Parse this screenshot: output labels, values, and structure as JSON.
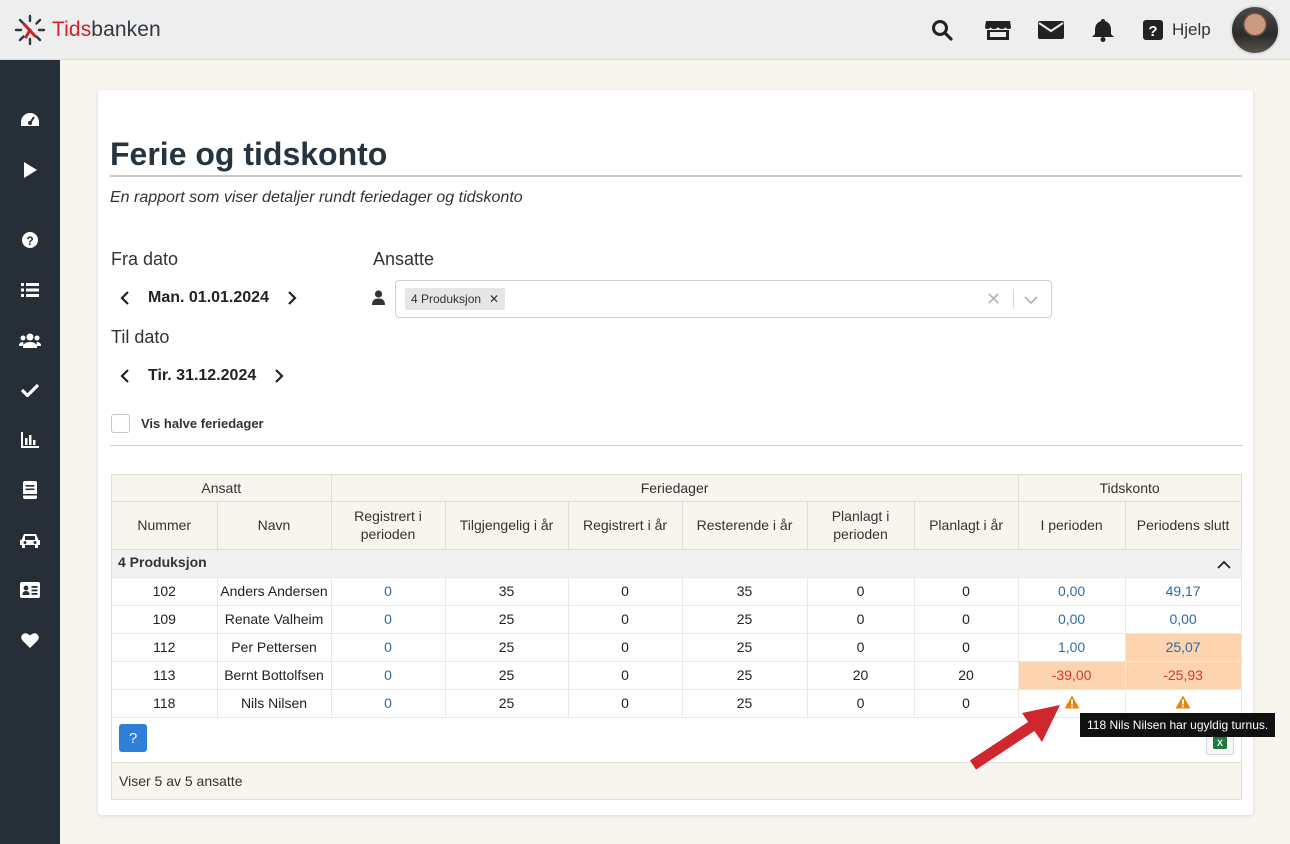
{
  "app": {
    "logo_prefix": "Tids",
    "logo_suffix": "banken"
  },
  "topbar": {
    "icons": [
      "search-icon",
      "store-icon",
      "mail-icon",
      "bell-icon",
      "help-icon"
    ],
    "help_label": "Hjelp"
  },
  "sidebar": {
    "items": [
      "dashboard-icon",
      "play-icon",
      "question-icon",
      "list-icon",
      "users-icon",
      "check-icon",
      "chart-icon",
      "book-icon",
      "car-icon",
      "id-card-icon",
      "heart-icon"
    ]
  },
  "page": {
    "title": "Ferie og tidskonto",
    "subtitle": "En rapport som viser detaljer rundt feriedager og tidskonto"
  },
  "filters": {
    "from_label": "Fra dato",
    "from_value": "Man. 01.01.2024",
    "to_label": "Til dato",
    "to_value": "Tir. 31.12.2024",
    "employees_label": "Ansatte",
    "employees_chip": "4 Produksjon",
    "half_days_label": "Vis halve feriedager"
  },
  "table": {
    "groups": [
      "Ansatt",
      "Feriedager",
      "Tidskonto"
    ],
    "columns": [
      "Nummer",
      "Navn",
      "Registrert i perioden",
      "Tilgjengelig i år",
      "Registrert i år",
      "Resterende i år",
      "Planlagt i perioden",
      "Planlagt i år",
      "I perioden",
      "Periodens slutt"
    ],
    "group_row": "4 Produksjon",
    "rows": [
      {
        "nummer": "102",
        "navn": "Anders Andersen",
        "reg_periode": "0",
        "tilgj": "35",
        "reg_aar": "0",
        "rest": "35",
        "plan_periode": "0",
        "plan_aar": "0",
        "i_perioden": "0,00",
        "slutt": "49,17"
      },
      {
        "nummer": "109",
        "navn": "Renate Valheim",
        "reg_periode": "0",
        "tilgj": "25",
        "reg_aar": "0",
        "rest": "25",
        "plan_periode": "0",
        "plan_aar": "0",
        "i_perioden": "0,00",
        "slutt": "0,00"
      },
      {
        "nummer": "112",
        "navn": "Per Pettersen",
        "reg_periode": "0",
        "tilgj": "25",
        "reg_aar": "0",
        "rest": "25",
        "plan_periode": "0",
        "plan_aar": "0",
        "i_perioden": "1,00",
        "slutt": "25,07"
      },
      {
        "nummer": "113",
        "navn": "Bernt Bottolfsen",
        "reg_periode": "0",
        "tilgj": "25",
        "reg_aar": "0",
        "rest": "25",
        "plan_periode": "20",
        "plan_aar": "20",
        "i_perioden": "-39,00",
        "slutt": "-25,93"
      },
      {
        "nummer": "118",
        "navn": "Nils Nilsen",
        "reg_periode": "0",
        "tilgj": "25",
        "reg_aar": "0",
        "rest": "25",
        "plan_periode": "0",
        "plan_aar": "0",
        "i_perioden": "warning-icon",
        "slutt": "warning-icon"
      }
    ],
    "footer": "Viser 5 av 5 ansatte",
    "help_button": "?"
  },
  "tooltip": "118 Nils Nilsen har ugyldig turnus.",
  "colors": {
    "sidebar": "#262f38",
    "brand_red": "#d0202a",
    "link": "#2e6da4",
    "negative": "#d9363e",
    "warn_bg": "#fcd4b0",
    "warn_icon": "#e8830c",
    "annotation_arrow": "#d0262e"
  }
}
